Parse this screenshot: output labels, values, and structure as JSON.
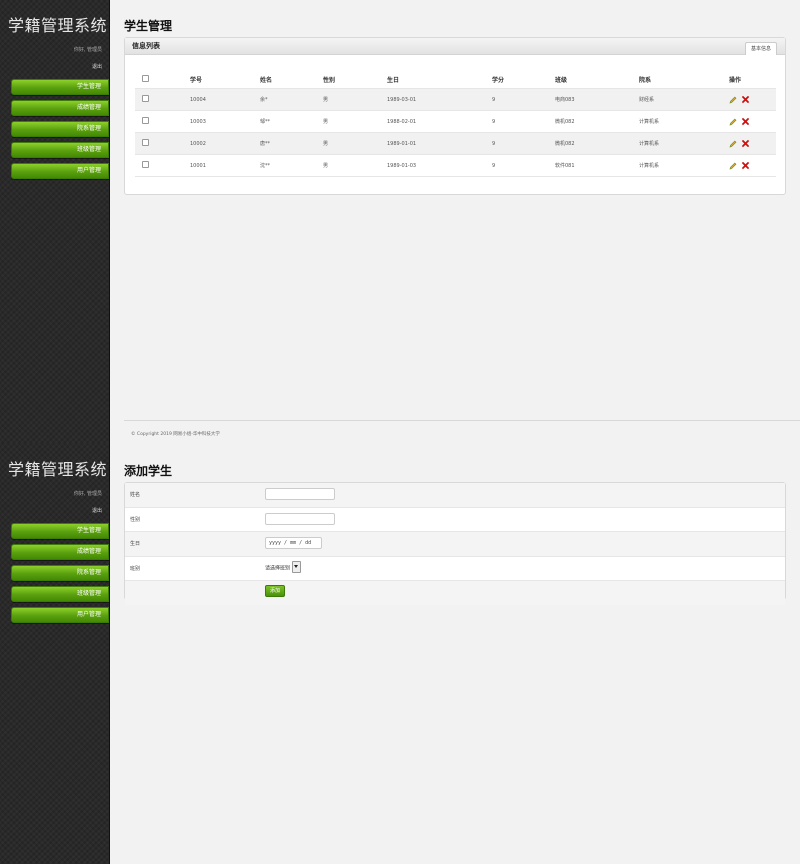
{
  "app": {
    "site_title": "学籍管理系统",
    "user_greeting": "你好, 管理员",
    "logout": "退出",
    "nav": [
      "学生管理",
      "成绩管理",
      "院系管理",
      "班级管理",
      "用户管理"
    ]
  },
  "list_page": {
    "title": "学生管理",
    "panel_title": "信息列表",
    "tab": "基本信息",
    "columns": [
      "学号",
      "姓名",
      "性别",
      "生日",
      "学分",
      "班级",
      "院系",
      "操作"
    ],
    "rows": [
      {
        "id": "10004",
        "name": "余*",
        "gender": "男",
        "birthday": "1989-03-01",
        "credit": "9",
        "class": "电商083",
        "dept": "财经系"
      },
      {
        "id": "10003",
        "name": "邹**",
        "gender": "男",
        "birthday": "1988-02-01",
        "credit": "9",
        "class": "微机082",
        "dept": "计算机系"
      },
      {
        "id": "10002",
        "name": "唐**",
        "gender": "男",
        "birthday": "1989-01-01",
        "credit": "9",
        "class": "微机082",
        "dept": "计算机系"
      },
      {
        "id": "10001",
        "name": "沈**",
        "gender": "男",
        "birthday": "1989-01-03",
        "credit": "9",
        "class": "软件081",
        "dept": "计算机系"
      }
    ],
    "copyright": "© Copyright 2019 网易小组-华中科技大学"
  },
  "add_page": {
    "title": "添加学生",
    "fields": {
      "name_label": "姓名",
      "gender_label": "性别",
      "birthday_label": "生日",
      "birthday_placeholder": "yyyy / mm / dd",
      "class_label": "班别",
      "class_select": "请选择班别"
    },
    "submit": "添加"
  },
  "colors": {
    "accent_green": "#5aa00e",
    "sidebar_bg": "#2a2a2a",
    "delete_red": "#cc1111"
  },
  "icons": {
    "edit": "pencil-icon",
    "delete": "delete-x-icon",
    "select_arrow": "dropdown-arrow-icon"
  }
}
